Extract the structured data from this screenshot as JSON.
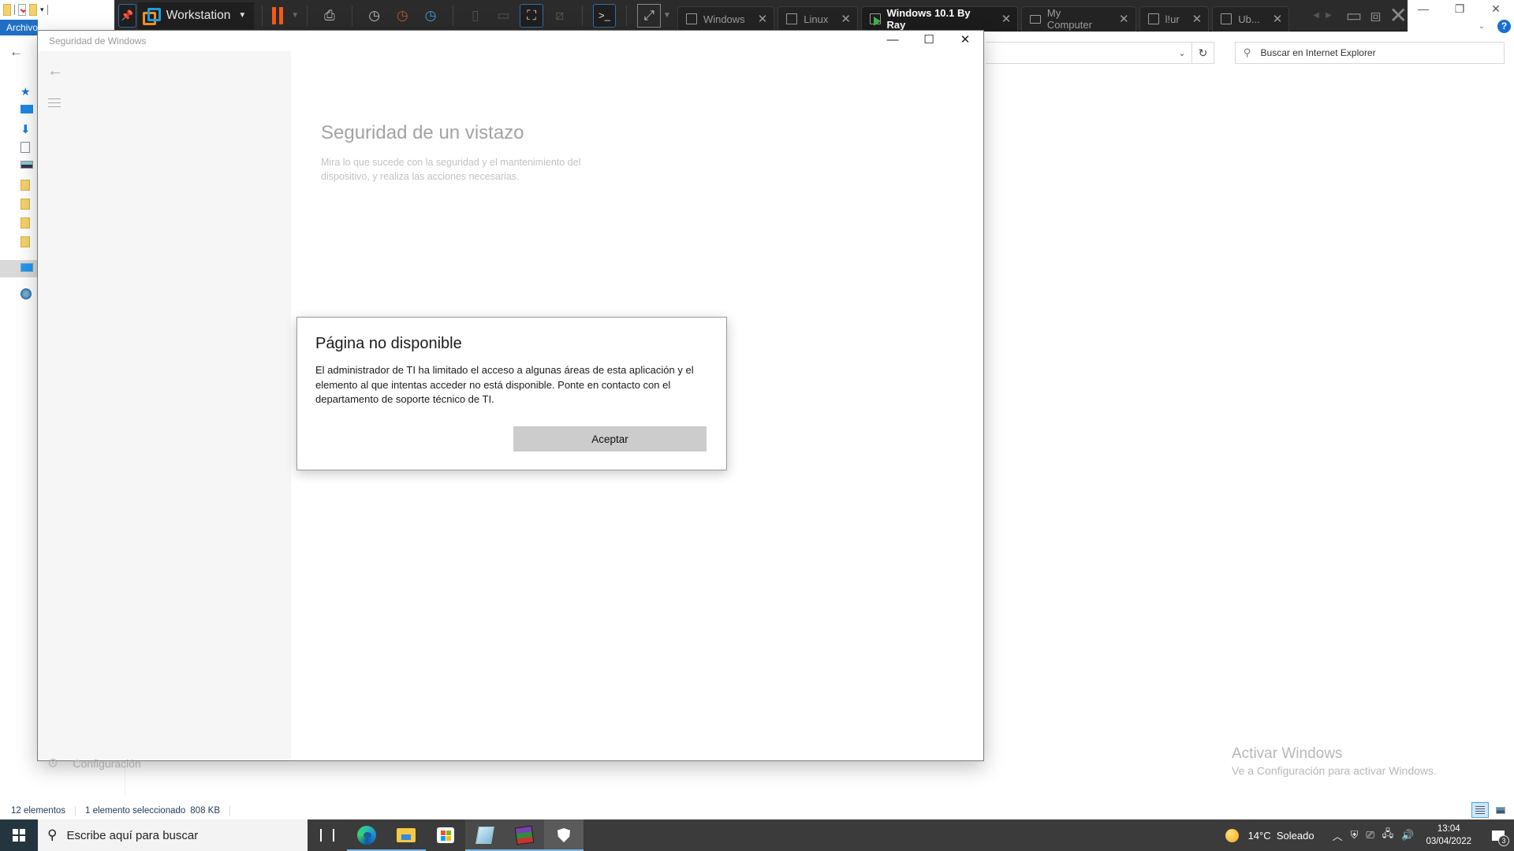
{
  "explorer": {
    "ribbon_file_tab": "Archivo",
    "address_refresh_icon": "refresh-icon",
    "search_placeholder": "Buscar en Internet Explorer",
    "status": {
      "item_count": "12 elementos",
      "selection": "1 elemento seleccionado",
      "size": "808 KB"
    },
    "window_controls": {
      "minimize": "—",
      "restore": "❐",
      "close": "✕"
    },
    "help_label": "?"
  },
  "vmware": {
    "brand_label": "Workstation",
    "tabs": [
      {
        "label": "Windows",
        "icon": "vm-icon",
        "active": false
      },
      {
        "label": "Linux",
        "icon": "vm-icon",
        "active": false
      },
      {
        "label": "Windows 10.1 By Ray",
        "icon": "vm-running-icon",
        "active": true
      },
      {
        "label": "My Computer",
        "icon": "computer-icon",
        "active": false
      },
      {
        "label": "l!ur",
        "icon": "vm-team-icon",
        "active": false
      },
      {
        "label": "Ub...",
        "icon": "vm-team-icon",
        "active": false
      }
    ],
    "close_glyph": "✕"
  },
  "security_window": {
    "title": "Seguridad de Windows",
    "controls": {
      "minimize": "—",
      "maximize": "☐",
      "close": "✕"
    },
    "heading": "Seguridad de un vistazo",
    "description": "Mira lo que sucede con la seguridad y el mantenimiento del dispositivo, y realiza las acciones necesarias.",
    "settings_label": "Configuración"
  },
  "dialog": {
    "title": "Página no disponible",
    "body": "El administrador de TI ha limitado el acceso a algunas áreas de esta aplicación y el elemento al que intentas acceder no está disponible. Ponte en contacto con el departamento de soporte técnico de TI.",
    "ok_label": "Aceptar"
  },
  "watermark": {
    "title": "Activar Windows",
    "subtitle": "Ve a Configuración para activar Windows."
  },
  "taskbar": {
    "search_placeholder": "Escribe aquí para buscar",
    "apps": [
      "task-view",
      "microsoft-edge",
      "file-explorer",
      "microsoft-store",
      "notepad",
      "winrar",
      "windows-security"
    ],
    "weather": {
      "temp": "14°C",
      "condition": "Soleado"
    },
    "time": "13:04",
    "date": "03/04/2022",
    "notification_count": "3"
  }
}
